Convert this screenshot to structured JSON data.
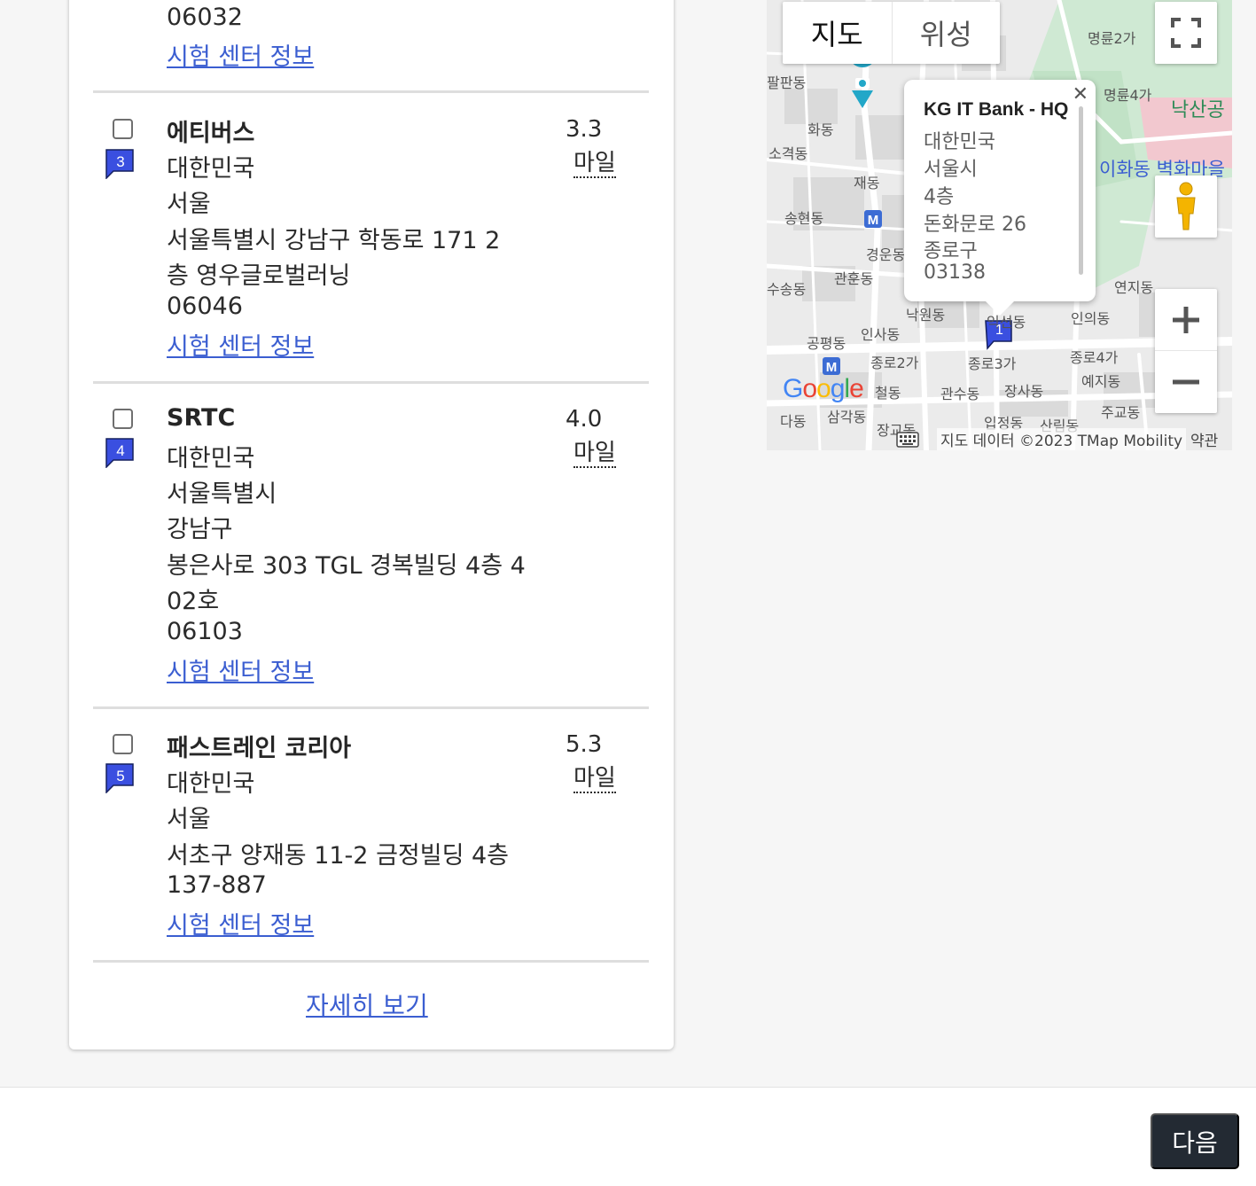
{
  "previous_item_tail": {
    "postal_code": "06032",
    "info_link": "시험 센터 정보"
  },
  "centers": [
    {
      "marker": "3",
      "name": "에티버스",
      "lines": [
        "대한민국",
        "서울",
        "서울특별시 강남구 학동로 171 2",
        "층 영우글로벌러닝",
        "06046"
      ],
      "distance": "3.3",
      "unit": "마일",
      "info_link": "시험 센터 정보"
    },
    {
      "marker": "4",
      "name": "SRTC",
      "lines": [
        "대한민국",
        "서울특별시",
        "강남구",
        "봉은사로 303 TGL 경복빌딩 4층 4",
        "02호",
        "06103"
      ],
      "distance": "4.0",
      "unit": "마일",
      "info_link": "시험 센터 정보"
    },
    {
      "marker": "5",
      "name": "패스트레인 코리아",
      "lines": [
        "대한민국",
        "서울",
        "서초구 양재동 11-2 금정빌딩 4층",
        "137-887"
      ],
      "distance": "5.3",
      "unit": "마일",
      "info_link": "시험 센터 정보"
    }
  ],
  "see_more": "자세히 보기",
  "map": {
    "type_map": "지도",
    "type_satellite": "위성",
    "info_window": {
      "title": "KG IT Bank - HQ",
      "lines": [
        "대한민국",
        "서울시",
        "4층",
        "돈화문로 26",
        "종로구",
        "03138"
      ]
    },
    "marker_label": "1",
    "labels": [
      "명륜2가",
      "명륜4가",
      "낙산공",
      "이화동 벽화마을",
      "팔판동",
      "화동",
      "소격동",
      "재동",
      "송현동",
      "경운동",
      "관훈동",
      "수송동",
      "낙원동",
      "인사동",
      "공평동",
      "종로2가",
      "종로3가",
      "종로4가",
      "인의동",
      "연지동",
      "예지동",
      "관수동",
      "장사동",
      "주교동",
      "입정동",
      "산림동",
      "삼각동",
      "다동",
      "철동",
      "장교동",
      "익선동"
    ],
    "attribution": "지도 데이터 ©2023 TMap Mobility",
    "terms": "약관",
    "google_logo": "Google"
  },
  "colors": {
    "link": "#3b5ed1",
    "marker": "#3a4fe0",
    "button_bg": "#232a33"
  },
  "footer": {
    "next_label": "다음"
  }
}
